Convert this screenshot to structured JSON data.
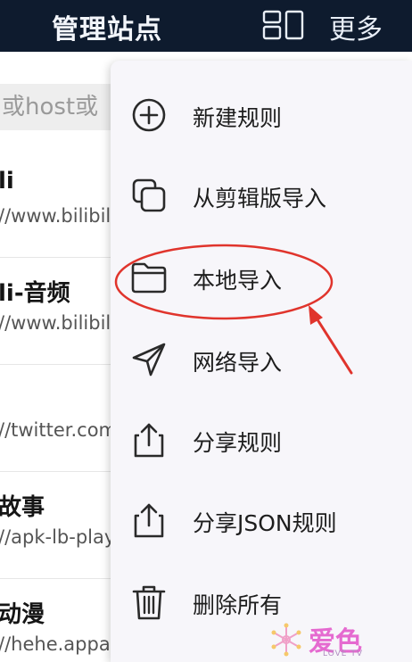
{
  "header": {
    "title": "管理站点",
    "more_label": "更多"
  },
  "search": {
    "placeholder": "或host或"
  },
  "sites": [
    {
      "name": "li",
      "url": "//www.bilibili"
    },
    {
      "name": "li-音频",
      "url": "//www.bilibili"
    },
    {
      "name": "",
      "url": "//twitter.com"
    },
    {
      "name": "故事",
      "url": "//apk-lb-play"
    },
    {
      "name": "动漫",
      "url": "//hehe.appabi.cc"
    }
  ],
  "menu": {
    "items": [
      {
        "label": "新建规则",
        "icon": "add-circle-icon"
      },
      {
        "label": "从剪辑版导入",
        "icon": "copy-icon"
      },
      {
        "label": "本地导入",
        "icon": "folder-icon"
      },
      {
        "label": "网络导入",
        "icon": "send-icon"
      },
      {
        "label": "分享规则",
        "icon": "share-icon"
      },
      {
        "label": "分享JSON规则",
        "icon": "share-icon"
      },
      {
        "label": "删除所有",
        "icon": "trash-icon"
      }
    ]
  },
  "annotation": {
    "color": "#e0342c"
  },
  "watermark": {
    "text": "爱色",
    "subtext": "LOVE TV"
  },
  "colors": {
    "topbar": "#0e1b2e",
    "menu_bg": "#f7f6fa"
  }
}
